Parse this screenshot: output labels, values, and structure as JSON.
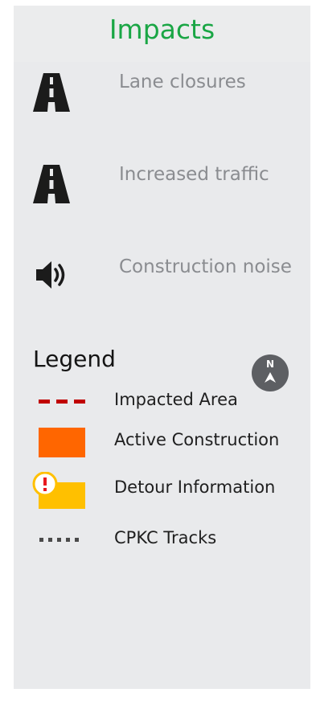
{
  "impacts": {
    "title": "Impacts",
    "items": [
      {
        "label": "Lane closures",
        "icon": "road-icon"
      },
      {
        "label": "Increased traffic",
        "icon": "road-icon"
      },
      {
        "label": "Construction noise",
        "icon": "speaker-icon"
      }
    ]
  },
  "legend": {
    "title": "Legend",
    "north_label": "N",
    "items": [
      {
        "label": "Impacted Area",
        "icon": "dashed-red-line-icon",
        "color": "#c00000"
      },
      {
        "label": "Active Construction",
        "icon": "orange-square-icon",
        "color": "#ff6600"
      },
      {
        "label": "Detour Information",
        "icon": "detour-warning-icon",
        "color": "#ffc000"
      },
      {
        "label": "CPKC Tracks",
        "icon": "dotted-track-line-icon",
        "color": "#4a4a4a"
      }
    ]
  }
}
